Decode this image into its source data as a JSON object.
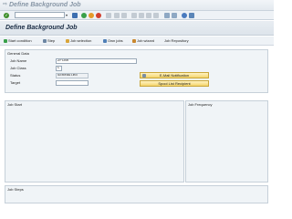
{
  "window": {
    "title": "Define Background Job"
  },
  "toolbar": {
    "command_value": "",
    "dropdown_glyph": "▾"
  },
  "page": {
    "title": "Define Background Job"
  },
  "app_toolbar": {
    "start_condition": "Start condition",
    "step": "Step",
    "job_selection": "Job selection",
    "own_jobs": "Own jobs",
    "job_wizard": "Job wizard",
    "job_repository": "Job Repository"
  },
  "general_data": {
    "title": "General Data",
    "job_name_label": "Job Name",
    "job_name_value": "ZFCBR",
    "job_class_label": "Job Class",
    "job_class_value": "C",
    "status_label": "Status",
    "status_value": "Scheduled",
    "target_label": "Target",
    "target_value": "",
    "email_button": "E-Mail Notification",
    "spool_button": "Spool List Recipient"
  },
  "sections": {
    "job_start": "Job Start",
    "job_frequency": "Job Frequency",
    "job_steps": "Job Steps"
  },
  "colors": {
    "accent": "#f4d56c",
    "title_blue": "#1a2c44",
    "ok_green": "#3f8f2c"
  }
}
